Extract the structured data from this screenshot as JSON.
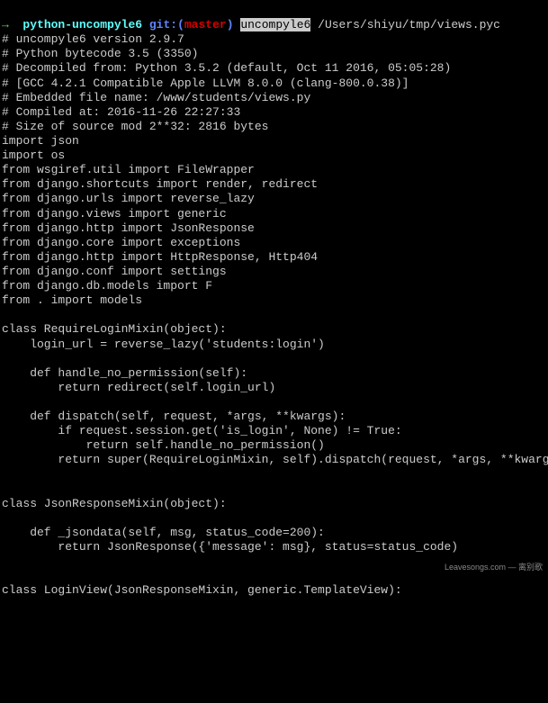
{
  "prompt": {
    "arrow": "→",
    "dir": "python-uncompyle6",
    "git_label": "git:(",
    "git_branch": "master",
    "git_close": ")",
    "command": "uncompyle6",
    "arg": "/Users/shiyu/tmp/views.pyc"
  },
  "header": [
    "# uncompyle6 version 2.9.7",
    "# Python bytecode 3.5 (3350)",
    "# Decompiled from: Python 3.5.2 (default, Oct 11 2016, 05:05:28)",
    "# [GCC 4.2.1 Compatible Apple LLVM 8.0.0 (clang-800.0.38)]",
    "# Embedded file name: /www/students/views.py",
    "# Compiled at: 2016-11-26 22:27:33",
    "# Size of source mod 2**32: 2816 bytes"
  ],
  "code": [
    "import json",
    "import os",
    "from wsgiref.util import FileWrapper",
    "from django.shortcuts import render, redirect",
    "from django.urls import reverse_lazy",
    "from django.views import generic",
    "from django.http import JsonResponse",
    "from django.core import exceptions",
    "from django.http import HttpResponse, Http404",
    "from django.conf import settings",
    "from django.db.models import F",
    "from . import models",
    "",
    "class RequireLoginMixin(object):",
    "    login_url = reverse_lazy('students:login')",
    "",
    "    def handle_no_permission(self):",
    "        return redirect(self.login_url)",
    "",
    "    def dispatch(self, request, *args, **kwargs):",
    "        if request.session.get('is_login', None) != True:",
    "            return self.handle_no_permission()",
    "        return super(RequireLoginMixin, self).dispatch(request, *args, **kwargs)",
    "",
    "",
    "class JsonResponseMixin(object):",
    "",
    "    def _jsondata(self, msg, status_code=200):",
    "        return JsonResponse({'message': msg}, status=status_code)",
    "",
    "",
    "class LoginView(JsonResponseMixin, generic.TemplateView):"
  ],
  "watermark": "Leavesongs.com — 离别歌"
}
